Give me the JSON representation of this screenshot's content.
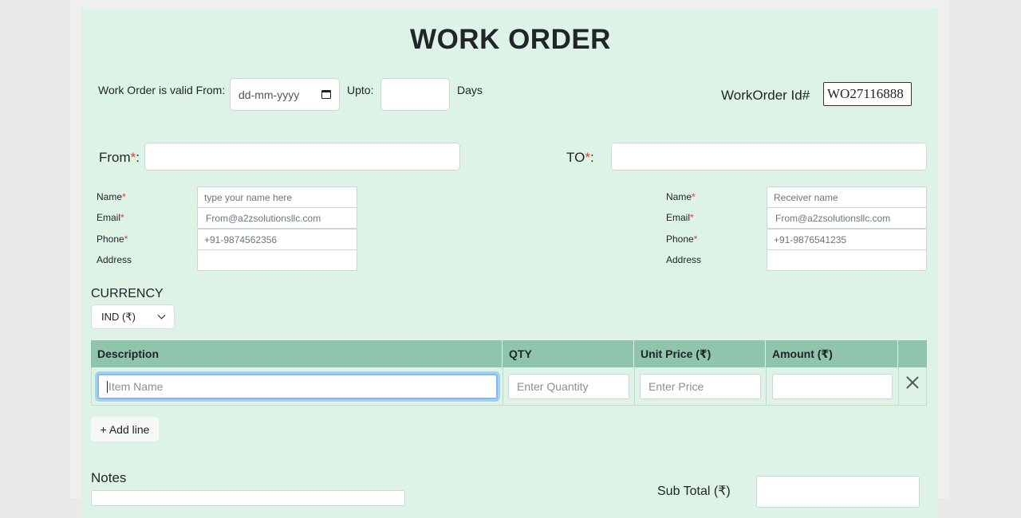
{
  "page": {
    "title": "WORK ORDER"
  },
  "validity": {
    "valid_from_label": "Work Order is valid From:",
    "date_placeholder": "dd-mm-yyyy",
    "upto_label": "Upto:",
    "upto_value": "",
    "days_label": "Days"
  },
  "workorder": {
    "id_label": "WorkOrder Id#",
    "id_value": "WO27116888"
  },
  "from_section": {
    "label": "From",
    "required_mark": "*",
    "colon": ":",
    "value": "",
    "fields": {
      "name_label": "Name",
      "name_placeholder": "type your name here",
      "email_label": "Email",
      "email_value": "From@a2zsolutionsllc.com",
      "phone_label": "Phone",
      "phone_value": "+91-9874562356",
      "address_label": "Address",
      "address_value": ""
    }
  },
  "to_section": {
    "label": "TO",
    "required_mark": "*",
    "colon": ":",
    "value": "",
    "fields": {
      "name_label": "Name",
      "name_placeholder": "Receiver name",
      "email_label": "Email",
      "email_value": "From@a2zsolutionsllc.com",
      "phone_label": "Phone",
      "phone_value": "+91-9876541235",
      "address_label": "Address",
      "address_value": ""
    }
  },
  "currency": {
    "label": "CURRENCY",
    "selected": "IND (₹)"
  },
  "table": {
    "headers": [
      "Description",
      "QTY",
      "Unit Price (₹)",
      "Amount (₹)"
    ],
    "row": {
      "description_placeholder": "Item Name",
      "qty_placeholder": "Enter Quantity",
      "price_placeholder": "Enter Price",
      "amount_value": ""
    }
  },
  "actions": {
    "add_line": "+ Add line"
  },
  "notes": {
    "label": "Notes"
  },
  "totals": {
    "subtotal_label": "Sub Total (₹)",
    "subtotal_value": ""
  },
  "colors": {
    "card_bg": "#dcf3e5",
    "table_header_bg": "#8fc5ad",
    "required": "#e53935",
    "focus_border": "#86b7fe"
  }
}
